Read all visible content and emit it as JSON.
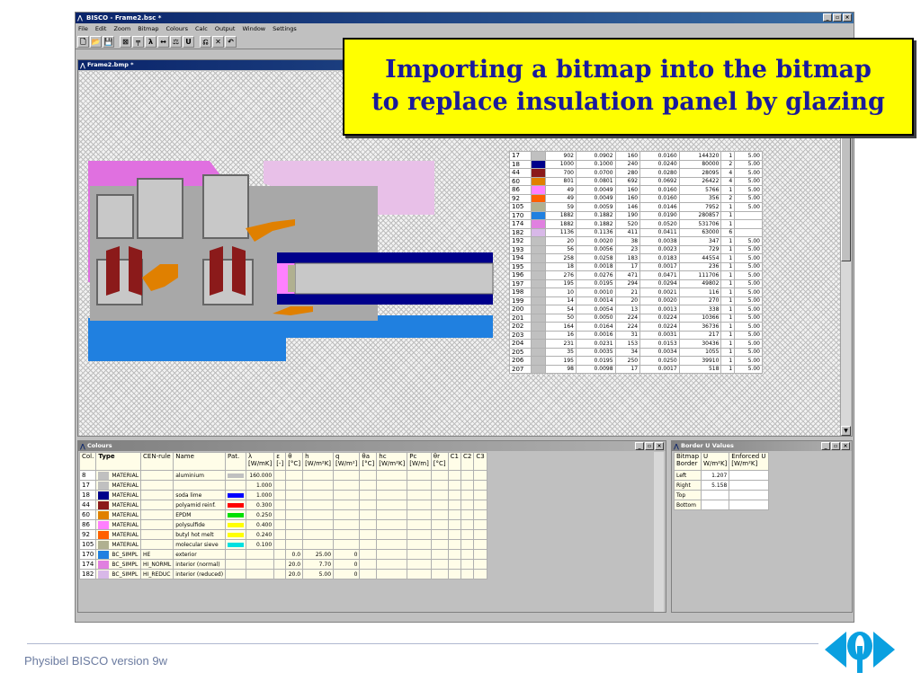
{
  "app": {
    "title": "BISCO - Frame2.bsc *",
    "child_title": "Frame2.bmp *"
  },
  "menu": [
    "File",
    "Edit",
    "Zoom",
    "Bitmap",
    "Colours",
    "Calc",
    "Output",
    "Window",
    "Settings"
  ],
  "toolbar": [
    "🗋",
    "📂",
    "💾",
    "⊠",
    "╤",
    "λ",
    "↔",
    "⚖",
    "U",
    "⎌",
    "✕",
    "↶"
  ],
  "callout": {
    "line1": "Importing a bitmap into the bitmap",
    "line2": "to replace insulation panel by glazing"
  },
  "bitmap_table": [
    {
      "id": "17",
      "color": "#c0c0c0",
      "c1": "902",
      "c2": "0.0902",
      "c3": "160",
      "c4": "0.0160",
      "c5": "144320",
      "c6": "1",
      "c7": "5.00"
    },
    {
      "id": "18",
      "color": "#00008b",
      "c1": "1000",
      "c2": "0.1000",
      "c3": "240",
      "c4": "0.0240",
      "c5": "80000",
      "c6": "2",
      "c7": "5.00"
    },
    {
      "id": "44",
      "color": "#8b1a1a",
      "c1": "700",
      "c2": "0.0700",
      "c3": "280",
      "c4": "0.0280",
      "c5": "28095",
      "c6": "4",
      "c7": "5.00"
    },
    {
      "id": "60",
      "color": "#e08000",
      "c1": "801",
      "c2": "0.0801",
      "c3": "692",
      "c4": "0.0692",
      "c5": "26422",
      "c6": "4",
      "c7": "5.00"
    },
    {
      "id": "86",
      "color": "#ff80ff",
      "c1": "49",
      "c2": "0.0049",
      "c3": "160",
      "c4": "0.0160",
      "c5": "5766",
      "c6": "1",
      "c7": "5.00"
    },
    {
      "id": "92",
      "color": "#ff6000",
      "c1": "49",
      "c2": "0.0049",
      "c3": "160",
      "c4": "0.0160",
      "c5": "356",
      "c6": "2",
      "c7": "5.00"
    },
    {
      "id": "105",
      "color": "#b0b090",
      "c1": "59",
      "c2": "0.0059",
      "c3": "146",
      "c4": "0.0146",
      "c5": "7952",
      "c6": "1",
      "c7": "5.00"
    },
    {
      "id": "170",
      "color": "#2080e0",
      "c1": "1882",
      "c2": "0.1882",
      "c3": "190",
      "c4": "0.0190",
      "c5": "280857",
      "c6": "1",
      "c7": ""
    },
    {
      "id": "174",
      "color": "#e080e0",
      "c1": "1882",
      "c2": "0.1882",
      "c3": "520",
      "c4": "0.0520",
      "c5": "531706",
      "c6": "1",
      "c7": ""
    },
    {
      "id": "182",
      "color": "#d8b8e8",
      "c1": "1136",
      "c2": "0.1136",
      "c3": "411",
      "c4": "0.0411",
      "c5": "63000",
      "c6": "6",
      "c7": ""
    },
    {
      "id": "192",
      "color": "#c0c0c0",
      "c1": "20",
      "c2": "0.0020",
      "c3": "38",
      "c4": "0.0038",
      "c5": "347",
      "c6": "1",
      "c7": "5.00"
    },
    {
      "id": "193",
      "color": "#c0c0c0",
      "c1": "56",
      "c2": "0.0056",
      "c3": "23",
      "c4": "0.0023",
      "c5": "729",
      "c6": "1",
      "c7": "5.00"
    },
    {
      "id": "194",
      "color": "#c0c0c0",
      "c1": "258",
      "c2": "0.0258",
      "c3": "183",
      "c4": "0.0183",
      "c5": "44554",
      "c6": "1",
      "c7": "5.00"
    },
    {
      "id": "195",
      "color": "#c0c0c0",
      "c1": "18",
      "c2": "0.0018",
      "c3": "17",
      "c4": "0.0017",
      "c5": "236",
      "c6": "1",
      "c7": "5.00"
    },
    {
      "id": "196",
      "color": "#c0c0c0",
      "c1": "276",
      "c2": "0.0276",
      "c3": "471",
      "c4": "0.0471",
      "c5": "111706",
      "c6": "1",
      "c7": "5.00"
    },
    {
      "id": "197",
      "color": "#c0c0c0",
      "c1": "195",
      "c2": "0.0195",
      "c3": "294",
      "c4": "0.0294",
      "c5": "49802",
      "c6": "1",
      "c7": "5.00"
    },
    {
      "id": "198",
      "color": "#c0c0c0",
      "c1": "10",
      "c2": "0.0010",
      "c3": "21",
      "c4": "0.0021",
      "c5": "116",
      "c6": "1",
      "c7": "5.00"
    },
    {
      "id": "199",
      "color": "#c0c0c0",
      "c1": "14",
      "c2": "0.0014",
      "c3": "20",
      "c4": "0.0020",
      "c5": "270",
      "c6": "1",
      "c7": "5.00"
    },
    {
      "id": "200",
      "color": "#c0c0c0",
      "c1": "54",
      "c2": "0.0054",
      "c3": "13",
      "c4": "0.0013",
      "c5": "338",
      "c6": "1",
      "c7": "5.00"
    },
    {
      "id": "201",
      "color": "#c0c0c0",
      "c1": "50",
      "c2": "0.0050",
      "c3": "224",
      "c4": "0.0224",
      "c5": "10366",
      "c6": "1",
      "c7": "5.00"
    },
    {
      "id": "202",
      "color": "#c0c0c0",
      "c1": "164",
      "c2": "0.0164",
      "c3": "224",
      "c4": "0.0224",
      "c5": "36736",
      "c6": "1",
      "c7": "5.00"
    },
    {
      "id": "203",
      "color": "#c0c0c0",
      "c1": "16",
      "c2": "0.0016",
      "c3": "31",
      "c4": "0.0031",
      "c5": "217",
      "c6": "1",
      "c7": "5.00"
    },
    {
      "id": "204",
      "color": "#c0c0c0",
      "c1": "231",
      "c2": "0.0231",
      "c3": "153",
      "c4": "0.0153",
      "c5": "30436",
      "c6": "1",
      "c7": "5.00"
    },
    {
      "id": "205",
      "color": "#c0c0c0",
      "c1": "35",
      "c2": "0.0035",
      "c3": "34",
      "c4": "0.0034",
      "c5": "1055",
      "c6": "1",
      "c7": "5.00"
    },
    {
      "id": "206",
      "color": "#c0c0c0",
      "c1": "195",
      "c2": "0.0195",
      "c3": "250",
      "c4": "0.0250",
      "c5": "39910",
      "c6": "1",
      "c7": "5.00"
    },
    {
      "id": "207",
      "color": "#c0c0c0",
      "c1": "98",
      "c2": "0.0098",
      "c3": "17",
      "c4": "0.0017",
      "c5": "518",
      "c6": "1",
      "c7": "5.00"
    }
  ],
  "colours": {
    "title": "Colours",
    "headers": [
      "Col.",
      "Type",
      "CEN-rule",
      "Name",
      "Pat.",
      "λ\n[W/mK]",
      "ε\n[-]",
      "θ\n[°C]",
      "h\n[W/m²K]",
      "q\n[W/m²]",
      "θa\n[°C]",
      "hc\n[W/m²K]",
      "Pc\n[W/m]",
      "θr\n[°C]",
      "C1",
      "C2",
      "C3"
    ],
    "rows": [
      {
        "col": "8",
        "color": "#c0c0c0",
        "type": "MATERIAL",
        "cen": "",
        "name": "aluminium",
        "pat": "#c0c0c0",
        "lambda": "160.000",
        "theta": "",
        "h": "",
        "q": ""
      },
      {
        "col": "17",
        "color": "#c0c0c0",
        "type": "MATERIAL",
        "cen": "",
        "name": "",
        "pat": "",
        "lambda": "1.000",
        "theta": "",
        "h": "",
        "q": ""
      },
      {
        "col": "18",
        "color": "#00008b",
        "type": "MATERIAL",
        "cen": "",
        "name": "soda lime",
        "pat": "#0000ff",
        "lambda": "1.000",
        "theta": "",
        "h": "",
        "q": ""
      },
      {
        "col": "44",
        "color": "#8b1a1a",
        "type": "MATERIAL",
        "cen": "",
        "name": "polyamid reinf.",
        "pat": "#ff0000",
        "lambda": "0.300",
        "theta": "",
        "h": "",
        "q": ""
      },
      {
        "col": "60",
        "color": "#e08000",
        "type": "MATERIAL",
        "cen": "",
        "name": "EPDM",
        "pat": "#00e000",
        "lambda": "0.250",
        "theta": "",
        "h": "",
        "q": ""
      },
      {
        "col": "86",
        "color": "#ff80ff",
        "type": "MATERIAL",
        "cen": "",
        "name": "polysulfide",
        "pat": "#ffff00",
        "lambda": "0.400",
        "theta": "",
        "h": "",
        "q": ""
      },
      {
        "col": "92",
        "color": "#ff6000",
        "type": "MATERIAL",
        "cen": "",
        "name": "butyl hot melt",
        "pat": "#ffff00",
        "lambda": "0.240",
        "theta": "",
        "h": "",
        "q": ""
      },
      {
        "col": "105",
        "color": "#b0b090",
        "type": "MATERIAL",
        "cen": "",
        "name": "molecular sieve",
        "pat": "#00e0e0",
        "lambda": "0.100",
        "theta": "",
        "h": "",
        "q": ""
      },
      {
        "col": "170",
        "color": "#2080e0",
        "type": "BC_SIMPL",
        "cen": "HE",
        "name": "exterior",
        "pat": "",
        "lambda": "",
        "theta": "0.0",
        "h": "25.00",
        "q": "0"
      },
      {
        "col": "174",
        "color": "#e080e0",
        "type": "BC_SIMPL",
        "cen": "HI_NORML",
        "name": "interior (normal)",
        "pat": "",
        "lambda": "",
        "theta": "20.0",
        "h": "7.70",
        "q": "0"
      },
      {
        "col": "182",
        "color": "#d8b8e8",
        "type": "BC_SIMPL",
        "cen": "HI_REDUC",
        "name": "interior (reduced)",
        "pat": "",
        "lambda": "",
        "theta": "20.0",
        "h": "5.00",
        "q": "0"
      }
    ]
  },
  "border_u": {
    "title": "Border U Values",
    "headers": [
      "Bitmap\nBorder",
      "U\nW/m²K]",
      "Enforced U\n[W/m²K]"
    ],
    "rows": [
      {
        "label": "Left",
        "u": "1.207",
        "e": ""
      },
      {
        "label": "Right",
        "u": "5.158",
        "e": ""
      },
      {
        "label": "Top",
        "u": "",
        "e": ""
      },
      {
        "label": "Bottom",
        "u": "",
        "e": ""
      }
    ]
  },
  "footer": "Physibel BISCO version 9w",
  "icons": {
    "app": "bisco-logo-icon",
    "brand": "physibel-logo-icon"
  }
}
